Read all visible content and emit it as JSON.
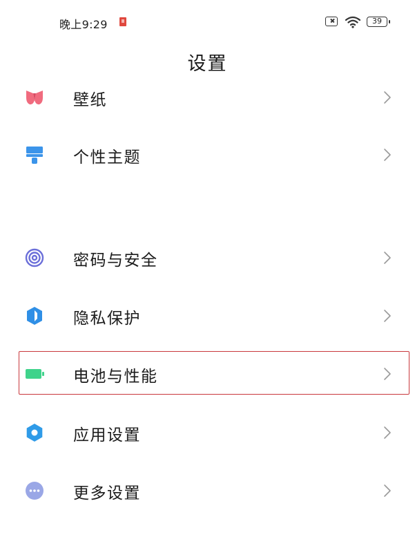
{
  "status_bar": {
    "time": "晚上9:29",
    "battery_level": "39",
    "icons": [
      "notification-icon",
      "sim-off-icon",
      "wifi-icon",
      "battery-icon"
    ]
  },
  "header": {
    "title": "设置"
  },
  "settings": {
    "items": [
      {
        "label": "壁纸",
        "icon": "wallpaper-icon",
        "color": "#f06b7e"
      },
      {
        "label": "个性主题",
        "icon": "theme-brush-icon",
        "color": "#3b94ea"
      },
      {
        "label": "密码与安全",
        "icon": "fingerprint-icon",
        "color": "#6b6fd9"
      },
      {
        "label": "隐私保护",
        "icon": "privacy-shield-icon",
        "color": "#2f8fe6"
      },
      {
        "label": "电池与性能",
        "icon": "battery-performance-icon",
        "color": "#3fd38b"
      },
      {
        "label": "应用设置",
        "icon": "app-settings-gear-icon",
        "color": "#2f9be8"
      },
      {
        "label": "更多设置",
        "icon": "more-settings-icon",
        "color": "#9aa7e6"
      }
    ],
    "highlighted_item": "电池与性能",
    "highlight_color": "#c8373b"
  }
}
